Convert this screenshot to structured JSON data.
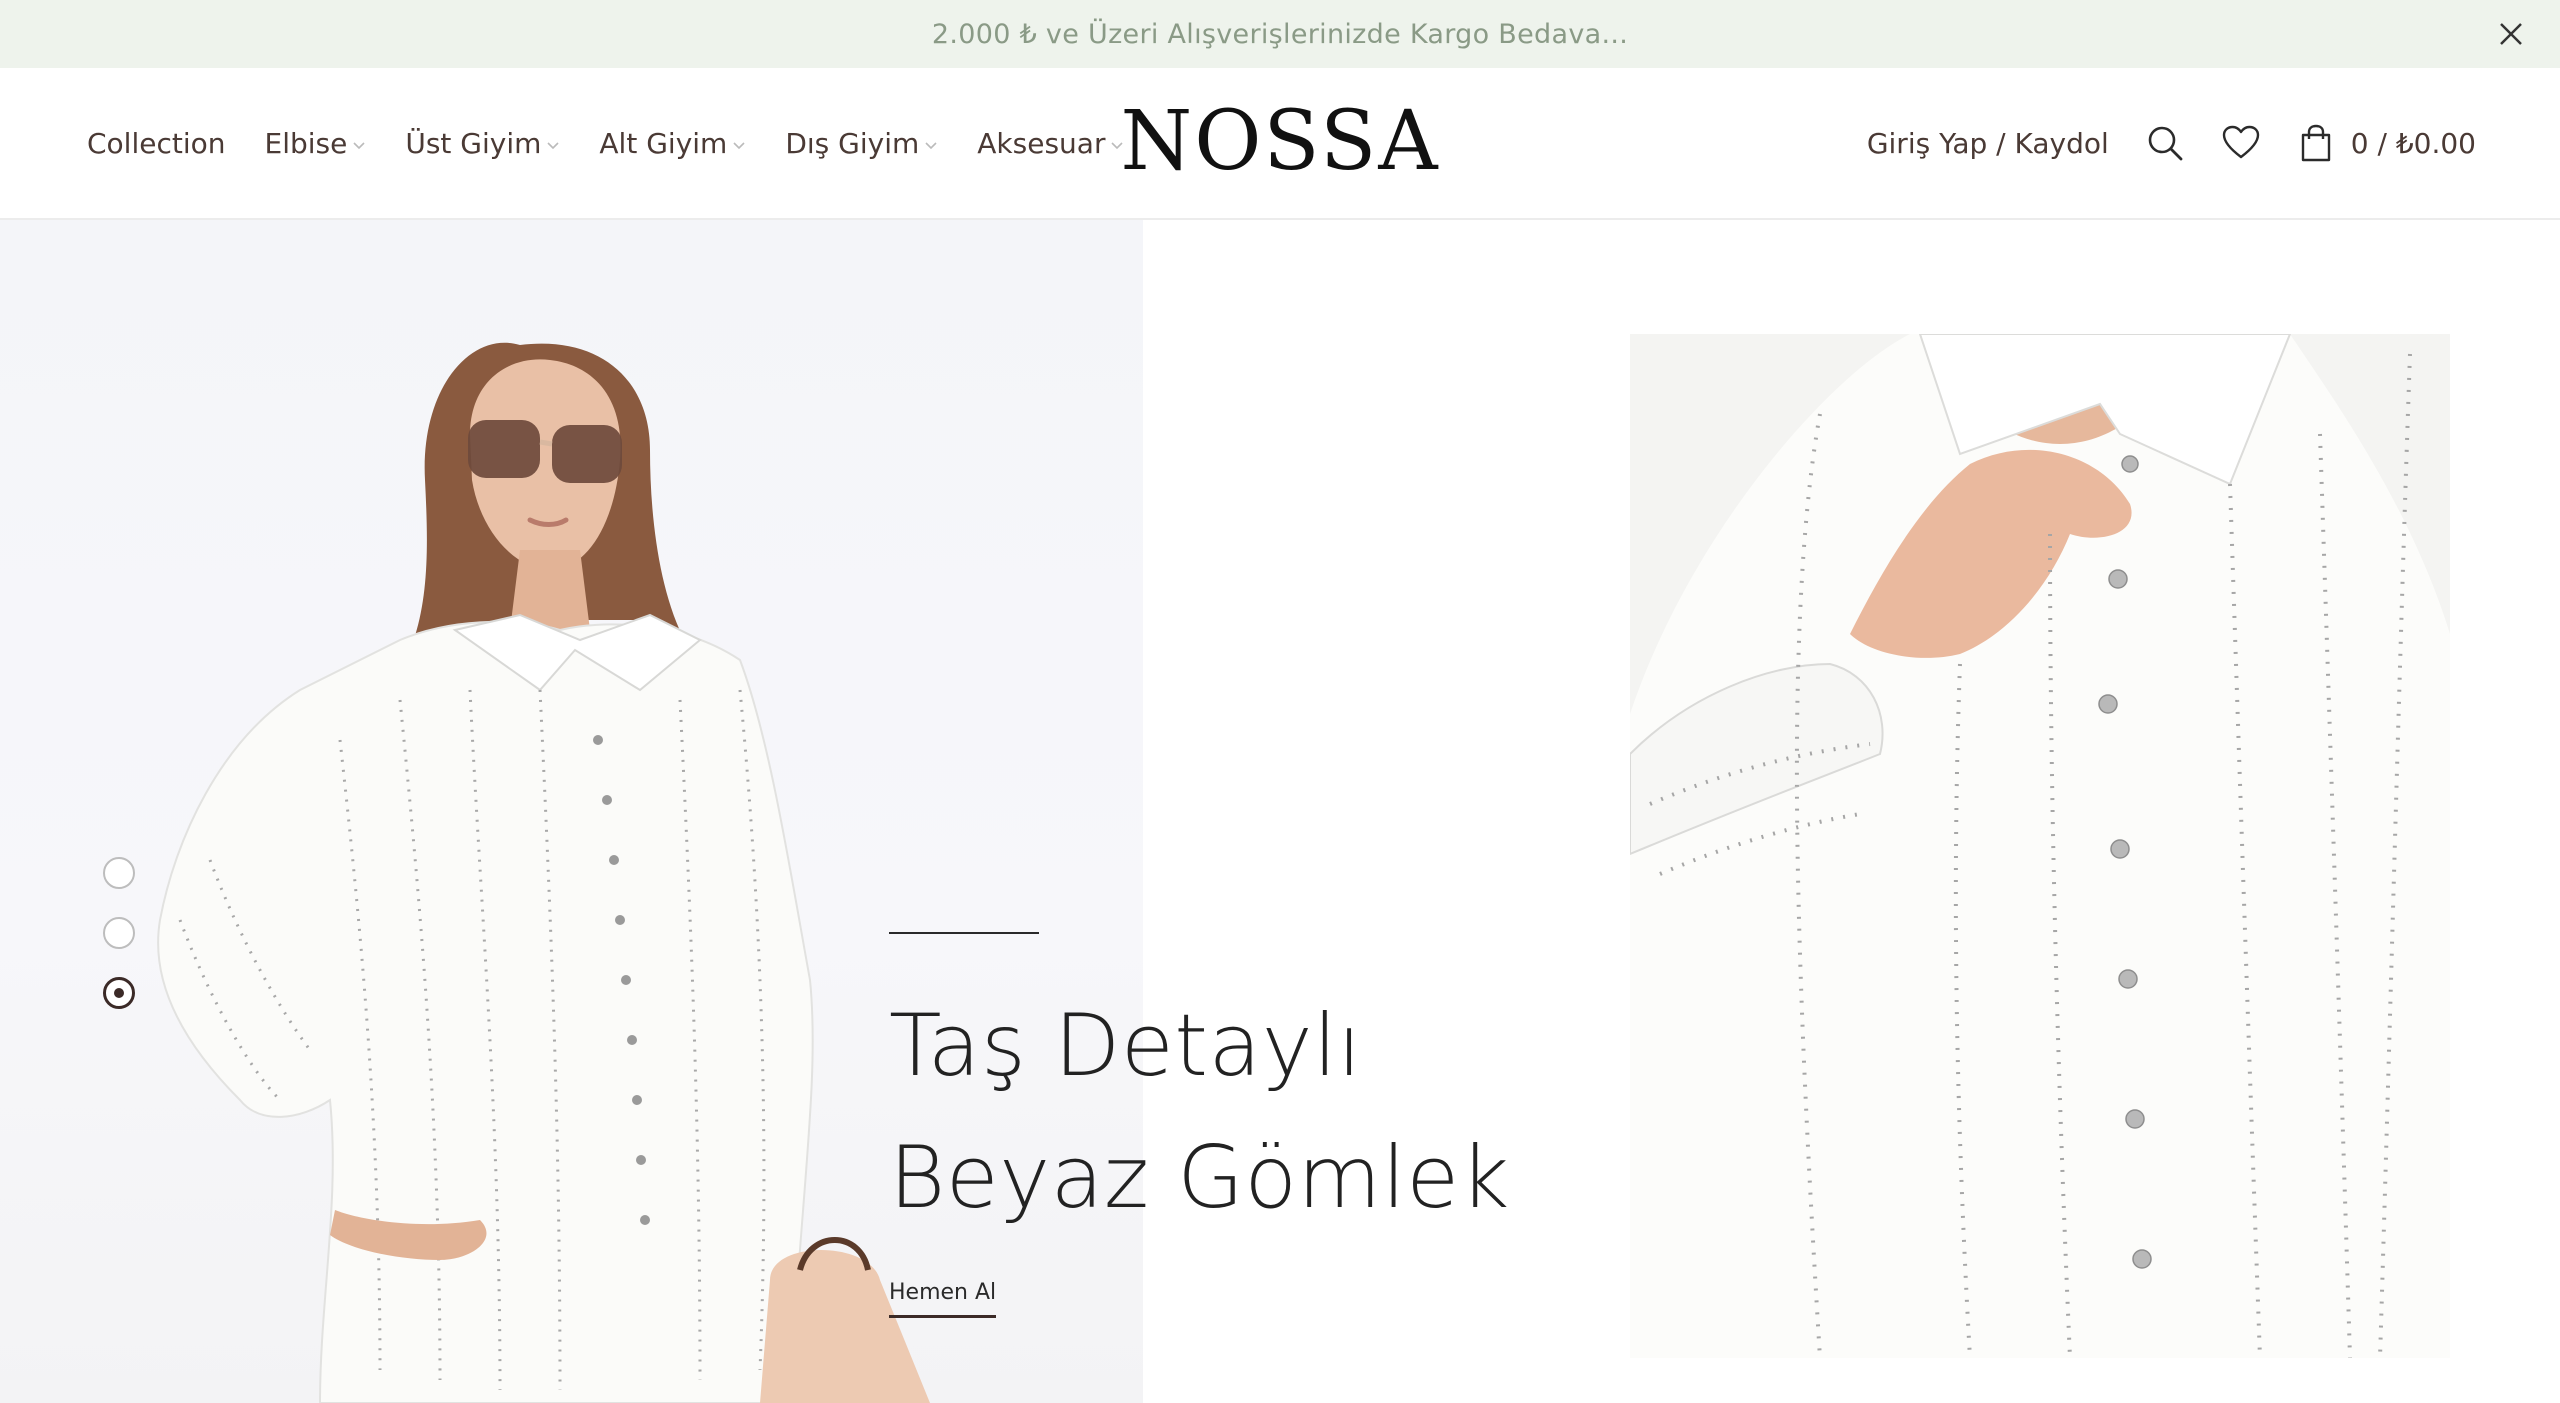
{
  "promo": {
    "text": "2.000 ₺ ve Üzeri Alışverişlerinizde Kargo Bedava...",
    "close_icon": "close-icon"
  },
  "nav": {
    "items": [
      {
        "label": "Collection",
        "has_dropdown": false
      },
      {
        "label": "Elbise",
        "has_dropdown": true
      },
      {
        "label": "Üst Giyim",
        "has_dropdown": true
      },
      {
        "label": "Alt Giyim",
        "has_dropdown": true
      },
      {
        "label": "Dış Giyim",
        "has_dropdown": true
      },
      {
        "label": "Aksesuar",
        "has_dropdown": true
      }
    ]
  },
  "brand": {
    "logo": "NOSSA"
  },
  "account": {
    "login_label": "Giriş Yap / Kaydol"
  },
  "cart": {
    "summary": "0 / ₺0.00"
  },
  "hero": {
    "title": "Taş Detaylı Beyaz Gömlek",
    "cta_label": "Hemen Al",
    "slides": 3,
    "active_slide": 3
  },
  "colors": {
    "promo_bg": "#eef3ec",
    "promo_text": "#8a9a86",
    "accent": "#3b2a27"
  }
}
